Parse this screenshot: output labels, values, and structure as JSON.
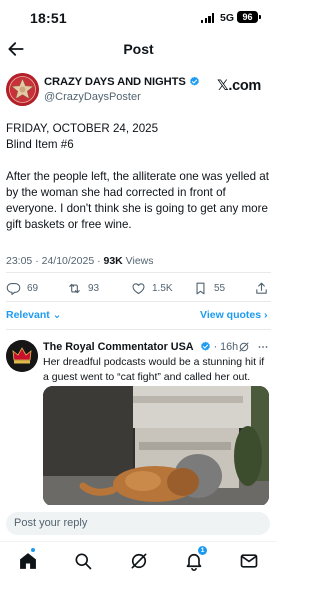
{
  "status_bar": {
    "time": "18:51",
    "network": "5G",
    "battery": "96"
  },
  "header": {
    "title": "Post"
  },
  "post": {
    "author_name": "CRAZY DAYS AND NIGHTS",
    "handle": "@CrazyDaysPoster",
    "brand": "𝕏.com",
    "lines": [
      "FRIDAY, OCTOBER 24, 2025",
      "Blind Item #6",
      "After the people left, the alliterate one was yelled at by the woman she had corrected in front of everyone. I don't think she is going to get any more gift baskets or free wine."
    ],
    "timestamp": "23:05 · 24/10/2025 · ",
    "views_count": "93K",
    "views_label": " Views",
    "stats": {
      "replies": "69",
      "reposts": "93",
      "likes": "1.5K",
      "bookmarks": "55"
    }
  },
  "sort": {
    "relevant_label": "Relevant ⌄",
    "view_quotes_label": "View quotes ›"
  },
  "reply": {
    "author_name": "The Royal Commentator USA",
    "time": " · 16h",
    "text": "Her dreadful podcasts would be a stunning hit if a guest went to “cat fight” and called her out."
  },
  "compose": {
    "placeholder": "Post your reply"
  },
  "tabbar": {
    "notifications_badge": "1"
  },
  "colors": {
    "accent": "#1d9bf0",
    "muted": "#536471",
    "text": "#0f1419"
  }
}
